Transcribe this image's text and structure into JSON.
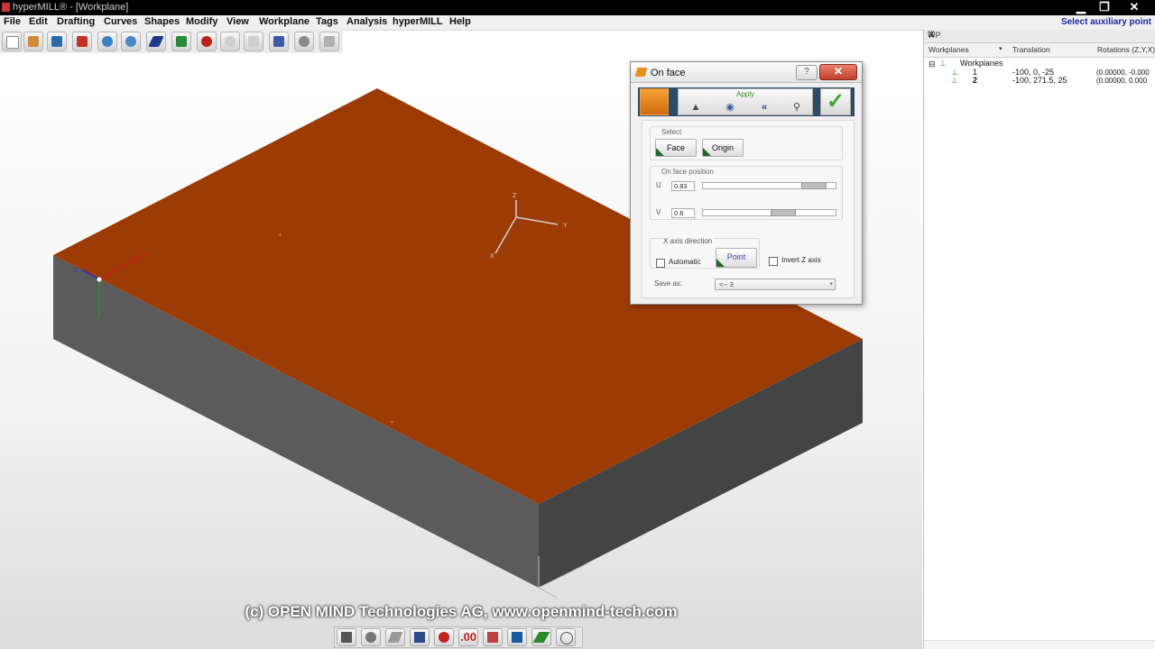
{
  "window": {
    "title": "hyperMILL® - [Workplane]",
    "controls": {
      "minimize": "▁",
      "restore": "❐",
      "close": "✕"
    }
  },
  "menu": {
    "items": [
      "File",
      "Edit",
      "Drafting",
      "Curves",
      "Shapes",
      "Modify",
      "View",
      "Workplane",
      "Tags",
      "Analysis",
      "hyperMILL",
      "Help"
    ],
    "status": "Select auxiliary point"
  },
  "toolbar": {
    "icons": [
      "new-file-icon",
      "open-file-icon",
      "save-icon",
      "open-folder-icon",
      "gear-icon",
      "numbered-gear-icon",
      "pen-icon",
      "info-icon",
      "undo-icon",
      "redo-icon",
      "redo-all-icon",
      "model-icon",
      "tool-icon",
      "warning-icon"
    ]
  },
  "viewport": {
    "watermark": "(c) OPEN MIND Technologies AG, www.openmind-tech.com",
    "colors": {
      "top_face": "#9c3a06",
      "side_face": "#5a5a5a",
      "front_face": "#454545"
    },
    "axis_labels": {
      "z": "Z",
      "y": "Y",
      "x": "X"
    }
  },
  "bottom_toolbar": {
    "icons": [
      "shade-icon",
      "view-sphere-icon",
      "sketch-icon",
      "brush-icon",
      "point-icon",
      "numbering-icon",
      "attribute-icon",
      "paint-icon",
      "pencil-icon",
      "mesh-icon"
    ],
    "counter": ".00"
  },
  "workplane_panel": {
    "title": "WP",
    "columns": [
      "Workplanes",
      "Translation",
      "Rotations (Z,Y,X)"
    ],
    "root": "Workplanes",
    "rows": [
      {
        "name": "1",
        "translation": "-100, 0, -25",
        "rotations": "(0.00000, -0.000"
      },
      {
        "name": "2",
        "translation": "-100, 271.5, 25",
        "rotations": "(0.00000, 0.000"
      }
    ]
  },
  "dialog": {
    "title": "On face",
    "help": "?",
    "close": "✕",
    "apply_label": "Apply",
    "apply_icons": [
      "pyramid-icon",
      "globe-icon",
      "chevrons-left-icon",
      "magnifier-icon"
    ],
    "ok_symbol": "✓",
    "select_group": {
      "label": "Select",
      "buttons": [
        "Face",
        "Origin"
      ]
    },
    "position_group": {
      "label": "On face position",
      "u": {
        "label": "U",
        "value": "0.83",
        "fraction": 0.83
      },
      "v": {
        "label": "V",
        "value": "0.6",
        "fraction": 0.6
      }
    },
    "xaxis_group": {
      "label": "X axis direction",
      "automatic_label": "Automatic",
      "automatic_checked": false,
      "point_label": "Point"
    },
    "invert_label": "Invert Z axis",
    "invert_checked": false,
    "save_as_label": "Save as:",
    "save_as_value": "<-- 3"
  }
}
